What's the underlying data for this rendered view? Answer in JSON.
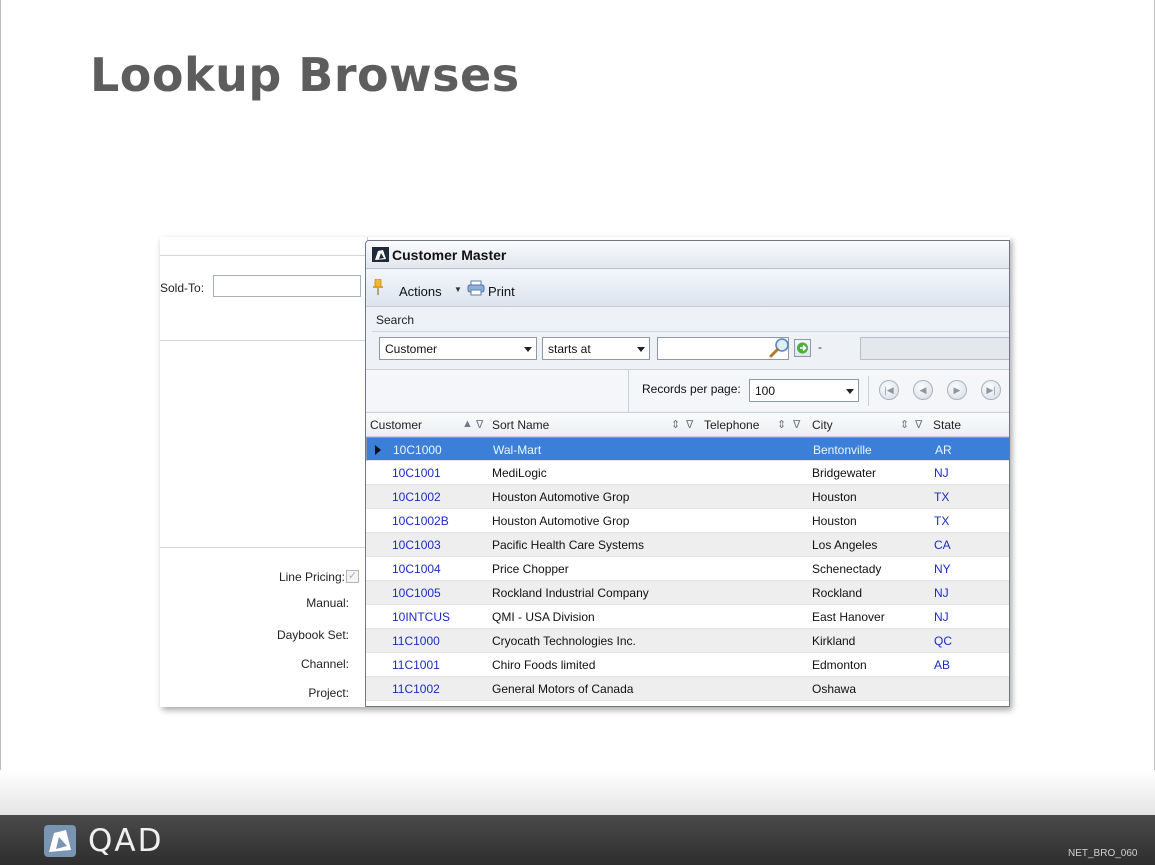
{
  "slide": {
    "title": "Lookup Browses",
    "footer_brand": "QAD",
    "footer_code": "NET_BRO_060"
  },
  "form": {
    "sold_to_label": "Sold-To:",
    "line_pricing_label": "Line Pricing:",
    "manual_label": "Manual:",
    "daybook_set_label": "Daybook Set:",
    "channel_label": "Channel:",
    "project_label": "Project:"
  },
  "window": {
    "title": "Customer Master",
    "actions_label": "Actions",
    "print_label": "Print",
    "search_label": "Search",
    "search_field": "Customer",
    "search_operator": "starts at",
    "search_value": "",
    "range_separator": "-",
    "records_per_page_label": "Records per page:",
    "records_per_page": "100"
  },
  "grid": {
    "columns": [
      "Customer",
      "Sort Name",
      "Telephone",
      "City",
      "State"
    ],
    "rows": [
      {
        "customer": "10C1000",
        "sort_name": "Wal-Mart",
        "city": "Bentonville",
        "state": "AR"
      },
      {
        "customer": "10C1001",
        "sort_name": "MediLogic",
        "city": "Bridgewater",
        "state": "NJ"
      },
      {
        "customer": "10C1002",
        "sort_name": "Houston Automotive Grop",
        "city": "Houston",
        "state": "TX"
      },
      {
        "customer": "10C1002B",
        "sort_name": "Houston Automotive Grop",
        "city": "Houston",
        "state": "TX"
      },
      {
        "customer": "10C1003",
        "sort_name": "Pacific Health Care Systems",
        "city": "Los Angeles",
        "state": "CA"
      },
      {
        "customer": "10C1004",
        "sort_name": "Price Chopper",
        "city": "Schenectady",
        "state": "NY"
      },
      {
        "customer": "10C1005",
        "sort_name": "Rockland Industrial Company",
        "city": "Rockland",
        "state": "NJ"
      },
      {
        "customer": "10INTCUS",
        "sort_name": "QMI - USA Division",
        "city": "East Hanover",
        "state": "NJ"
      },
      {
        "customer": "11C1000",
        "sort_name": "Cryocath Technologies Inc.",
        "city": "Kirkland",
        "state": "QC"
      },
      {
        "customer": "11C1001",
        "sort_name": "Chiro Foods limited",
        "city": "Edmonton",
        "state": "AB"
      },
      {
        "customer": "11C1002",
        "sort_name": "General Motors of Canada",
        "city": "Oshawa",
        "state": ""
      }
    ]
  },
  "colors": {
    "selection": "#3b7fd9",
    "link_blue": "#1c2cc4",
    "title_gray": "#5d5d5d",
    "footer_dark": "#3a3a3a"
  }
}
